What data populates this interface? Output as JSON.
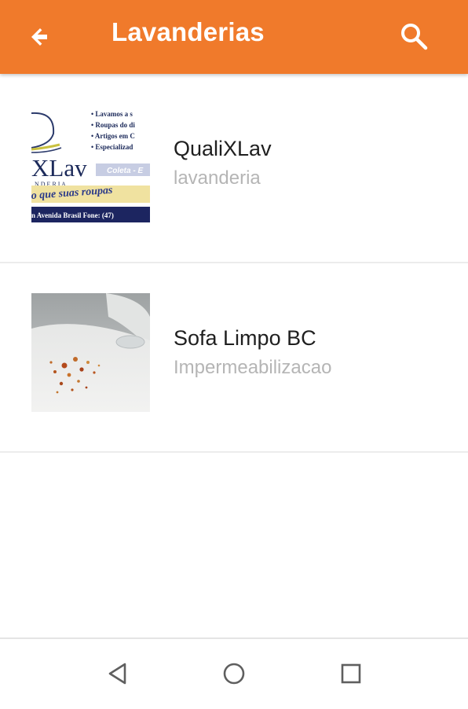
{
  "appbar": {
    "title": "Lavanderias",
    "back_icon": "arrow-back-icon",
    "search_icon": "search-icon",
    "color": "#f07a2b"
  },
  "list": [
    {
      "name": "QualiXLav",
      "category": "lavanderia",
      "thumbnail": {
        "lines": [
          "• Lavamos a s",
          "• Roupas do di",
          "• Artigos em C",
          "• Especializad"
        ],
        "logo_text": "XLav",
        "logo_sub": "N D E R I A",
        "tag": "Coleta - E",
        "slogan": "o que suas roupas",
        "footer": "n Avenida Brasil   Fone: (47)"
      }
    },
    {
      "name": "Sofa Limpo BC",
      "category": "Impermeabilizacao"
    }
  ],
  "navbar": {
    "back_icon": "nav-back-icon",
    "home_icon": "nav-home-icon",
    "recents_icon": "nav-recents-icon"
  }
}
